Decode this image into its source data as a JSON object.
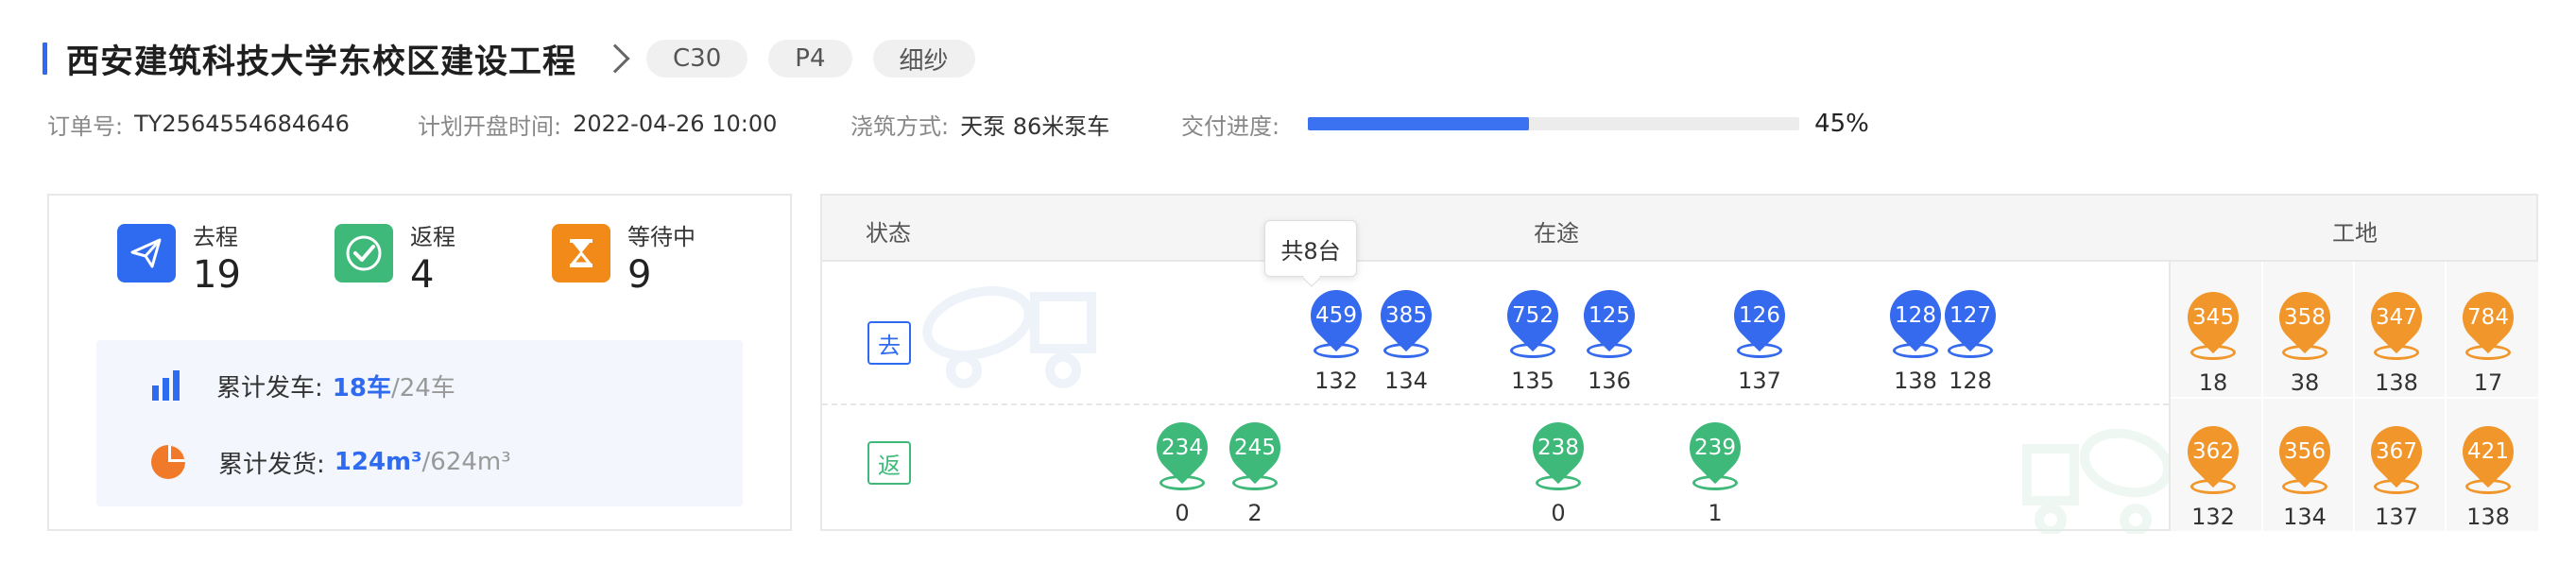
{
  "header": {
    "title": "西安建筑科技大学东校区建设工程",
    "tags": [
      "C30",
      "P4",
      "细纱"
    ]
  },
  "meta": {
    "order_label": "订单号:",
    "order_value": "TY2564554684646",
    "plan_label": "计划开盘时间:",
    "plan_value": "2022-04-26 10:00",
    "pour_label": "浇筑方式:",
    "pour_value": "天泵 86米泵车",
    "progress_label": "交付进度:",
    "progress_fraction": 0.45,
    "progress_text": "45%"
  },
  "stats": [
    {
      "label": "去程",
      "value": "19",
      "icon": "paper-plane-icon",
      "color": "#2f6bf0"
    },
    {
      "label": "返程",
      "value": "4",
      "icon": "check-icon",
      "color": "#3fb97a"
    },
    {
      "label": "等待中",
      "value": "9",
      "icon": "hourglass-icon",
      "color": "#f28a1a"
    }
  ],
  "totals": {
    "trucks_label": "累计发车:",
    "trucks_done": "18车",
    "trucks_total": "/24车",
    "volume_label": "累计发货:",
    "volume_done": "124m³",
    "volume_total": "/624m³"
  },
  "panel": {
    "col_status": "状态",
    "col_transit": "在途",
    "col_site": "工地",
    "row_outbound": "去",
    "row_return": "返",
    "tooltip": "共8台"
  },
  "colors": {
    "outbound": "#3569ee",
    "return": "#3fb97a",
    "site": "#f0962b"
  },
  "outbound_pins": [
    {
      "id": "459",
      "label": "132"
    },
    {
      "id": "385",
      "label": "134"
    },
    {
      "id": "752",
      "label": "135"
    },
    {
      "id": "125",
      "label": "136"
    },
    {
      "id": "126",
      "label": "137"
    },
    {
      "id": "128",
      "label": "138"
    },
    {
      "id": "127",
      "label": "128"
    }
  ],
  "return_pins": [
    {
      "id": "234",
      "label": "0"
    },
    {
      "id": "245",
      "label": "2"
    },
    {
      "id": "238",
      "label": "0"
    },
    {
      "id": "239",
      "label": "1"
    }
  ],
  "site_pins_top": [
    {
      "id": "345",
      "label": "18"
    },
    {
      "id": "358",
      "label": "38"
    },
    {
      "id": "347",
      "label": "138"
    },
    {
      "id": "784",
      "label": "17"
    }
  ],
  "site_pins_bottom": [
    {
      "id": "362",
      "label": "132"
    },
    {
      "id": "356",
      "label": "134"
    },
    {
      "id": "367",
      "label": "137"
    },
    {
      "id": "421",
      "label": "138"
    }
  ]
}
